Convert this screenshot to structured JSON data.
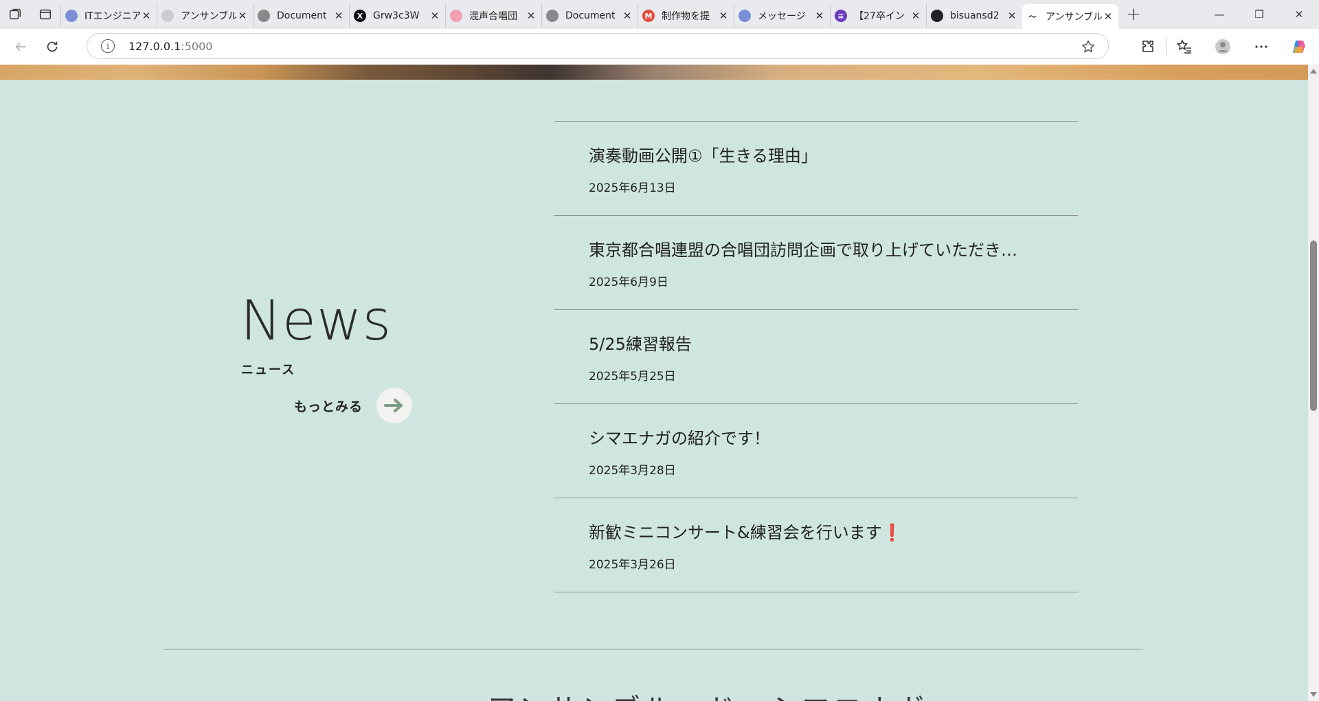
{
  "browser": {
    "tabs": [
      {
        "label": "ITエンジニア",
        "icon": "globe-blue",
        "color": "#7a8fd6",
        "glyph": ""
      },
      {
        "label": "アンサンブル",
        "icon": "search-logo",
        "color": "#cccccc",
        "glyph": ""
      },
      {
        "label": "Document",
        "icon": "globe",
        "color": "#888888",
        "glyph": ""
      },
      {
        "label": "Grw3c3W",
        "icon": "x-logo",
        "color": "#111111",
        "glyph": "X"
      },
      {
        "label": "混声合唱団",
        "icon": "sparkle",
        "color": "#f0a0b0",
        "glyph": ""
      },
      {
        "label": "Document",
        "icon": "globe",
        "color": "#888888",
        "glyph": ""
      },
      {
        "label": "制作物を提",
        "icon": "gmail",
        "color": "#e24b3b",
        "glyph": "M"
      },
      {
        "label": "メッセージ",
        "icon": "globe-blue",
        "color": "#7a8fd6",
        "glyph": ""
      },
      {
        "label": "【27卒イン",
        "icon": "form",
        "color": "#6a3bbf",
        "glyph": "≡"
      },
      {
        "label": "bisuansd2",
        "icon": "github",
        "color": "#222222",
        "glyph": ""
      },
      {
        "label": "アンサンブル",
        "icon": "bird",
        "color": "#ffffff",
        "glyph": ""
      }
    ],
    "url_host": "127.0.0.1",
    "url_port": ":5000"
  },
  "news": {
    "heading": "News",
    "subheading": "ニュース",
    "more_label": "もっとみる",
    "items": [
      {
        "title": "演奏動画公開①「生きる理由」",
        "date": "2025年6月13日"
      },
      {
        "title": "東京都合唱連盟の合唱団訪問企画で取り上げていただき…",
        "date": "2025年6月9日"
      },
      {
        "title": "5/25練習報告",
        "date": "2025年5月25日"
      },
      {
        "title": "シマエナガの紹介です！",
        "date": "2025年3月28日"
      },
      {
        "title": "新歓ミニコンサート&練習会を行います",
        "title_suffix": "❗",
        "date": "2025年3月26日"
      }
    ]
  },
  "next_section": {
    "heading": "アンサンブル・ド・シマエナガ"
  }
}
